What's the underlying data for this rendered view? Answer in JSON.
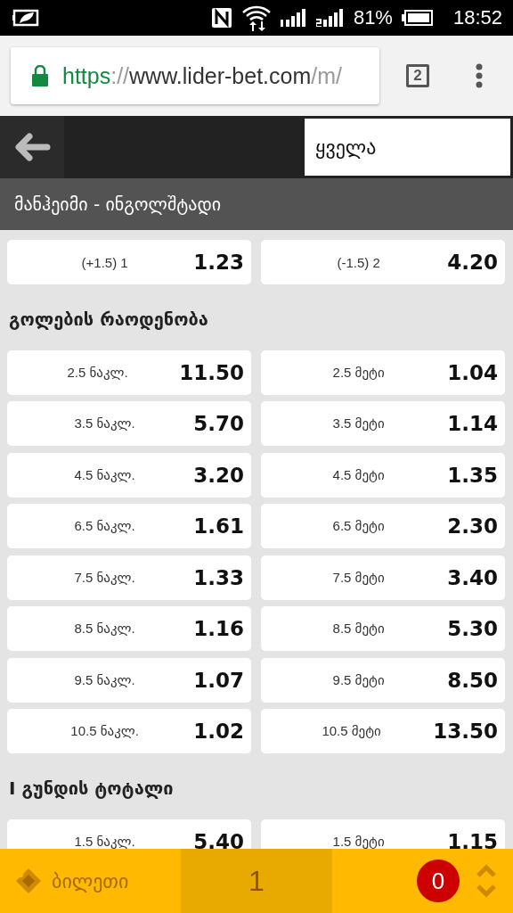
{
  "status_bar": {
    "battery": "81%",
    "time": "18:52"
  },
  "browser": {
    "url_scheme": "https",
    "url_separator": "://",
    "url_host": "www.lider-bet.com",
    "url_path": "/m/",
    "tab_count": "2"
  },
  "header": {
    "filter": "ყველა"
  },
  "match": {
    "title": "მანჰეიმი - ინგოლშტადი"
  },
  "sections": [
    {
      "rows": [
        [
          {
            "label": "(+1.5) 1",
            "odds": "1.23"
          },
          {
            "label": "(-1.5) 2",
            "odds": "4.20"
          }
        ]
      ]
    },
    {
      "title": "გოლების რაოდენობა",
      "rows": [
        [
          {
            "label": "2.5 ნაკლ.",
            "odds": "11.50"
          },
          {
            "label": "2.5 მეტი",
            "odds": "1.04"
          }
        ],
        [
          {
            "label": "3.5 ნაკლ.",
            "odds": "5.70"
          },
          {
            "label": "3.5 მეტი",
            "odds": "1.14"
          }
        ],
        [
          {
            "label": "4.5 ნაკლ.",
            "odds": "3.20"
          },
          {
            "label": "4.5 მეტი",
            "odds": "1.35"
          }
        ],
        [
          {
            "label": "6.5 ნაკლ.",
            "odds": "1.61"
          },
          {
            "label": "6.5 მეტი",
            "odds": "2.30"
          }
        ],
        [
          {
            "label": "7.5 ნაკლ.",
            "odds": "1.33"
          },
          {
            "label": "7.5 მეტი",
            "odds": "3.40"
          }
        ],
        [
          {
            "label": "8.5 ნაკლ.",
            "odds": "1.16"
          },
          {
            "label": "8.5 მეტი",
            "odds": "5.30"
          }
        ],
        [
          {
            "label": "9.5 ნაკლ.",
            "odds": "1.07"
          },
          {
            "label": "9.5 მეტი",
            "odds": "8.50"
          }
        ],
        [
          {
            "label": "10.5 ნაკლ.",
            "odds": "1.02"
          },
          {
            "label": "10.5 მეტი",
            "odds": "13.50"
          }
        ]
      ]
    },
    {
      "title": "I გუნდის ტოტალი",
      "rows": [
        [
          {
            "label": "1.5 ნაკლ.",
            "odds": "5.40"
          },
          {
            "label": "1.5 მეტი",
            "odds": "1.15"
          }
        ]
      ]
    }
  ],
  "bet_slip": {
    "label": "ბილეთი",
    "selections": "1",
    "count": "0"
  }
}
